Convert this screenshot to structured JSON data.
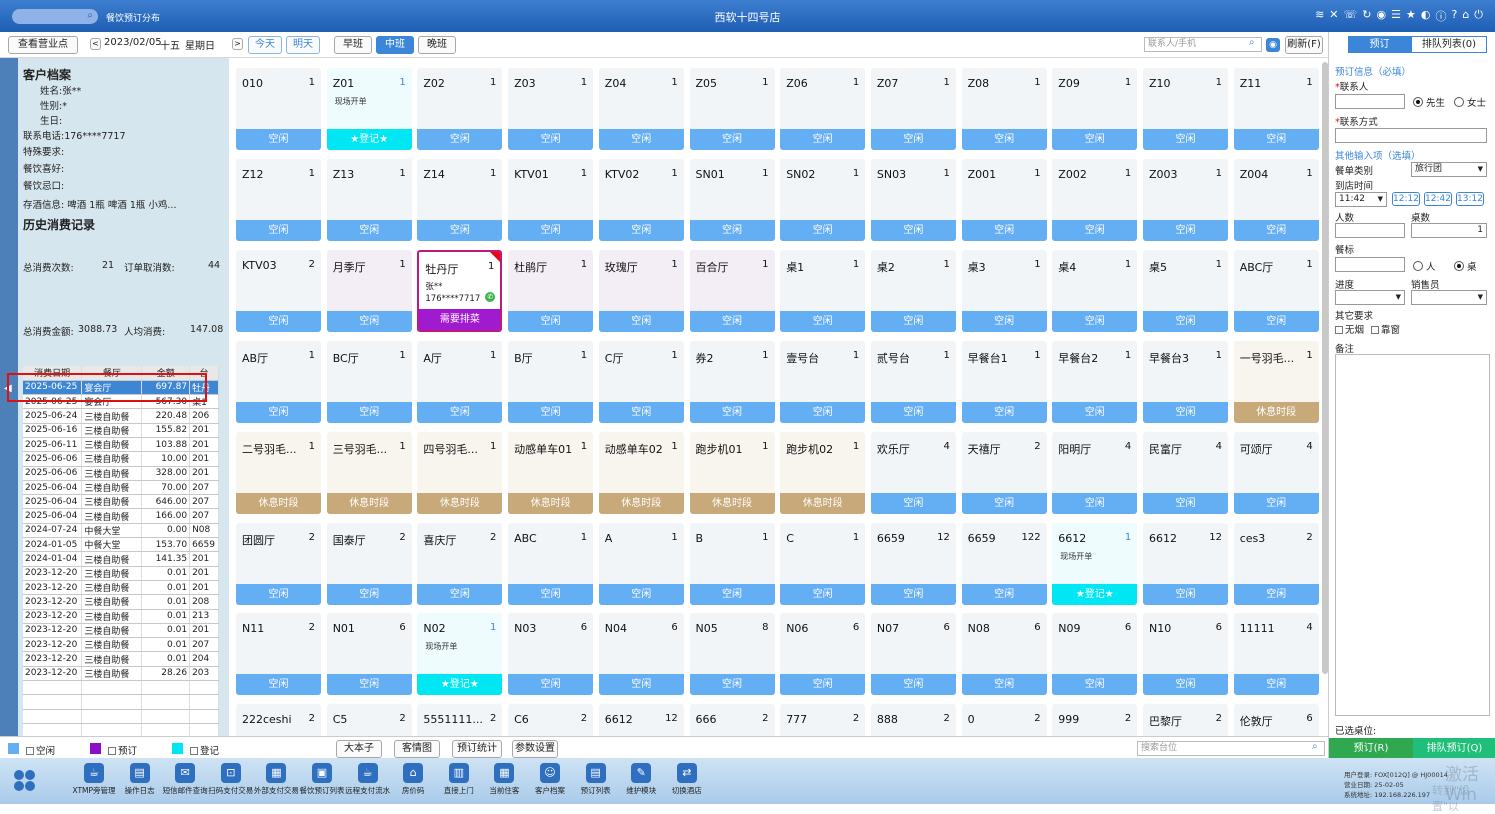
{
  "topbar": {
    "subtitle": "餐饮预订分布",
    "title": "西软十四号店",
    "icons": [
      "wifi-icon",
      "tools-icon",
      "phone-icon",
      "refresh-icon",
      "palette-icon",
      "menu-icon",
      "star-icon",
      "contrast-icon",
      "info-icon",
      "help-icon",
      "home-icon",
      "power-icon"
    ]
  },
  "toolbar": {
    "view_btn": "查看营业点",
    "prev": "<",
    "date": "2023/02/05",
    "lunar": "十五",
    "weekday": "星期日",
    "next": ">",
    "today": "今天",
    "tomorrow": "明天",
    "shifts": [
      "早班",
      "中班",
      "晚班"
    ],
    "contact_placeholder": "联系人/手机",
    "refresh": "刷新(F)"
  },
  "customer": {
    "title": "客户档案",
    "name_label": "姓名:",
    "name": "张**",
    "gender_label": "性别:",
    "gender": "*",
    "birthday_label": "生日:",
    "phone_label": "联系电话:",
    "phone": "176****7717",
    "special_label": "特殊要求:",
    "pref_label": "餐饮喜好:",
    "taboo_label": "餐饮忌口:",
    "wine_label": "存酒信息:",
    "wine": "啤酒 1瓶  啤酒 1瓶  小鸡..."
  },
  "history": {
    "title": "历史消费记录",
    "count_label": "总消费次数:",
    "count": "21",
    "cancel_label": "订单取消数:",
    "cancel": "44",
    "amount_label": "总消费金额:",
    "amount": "3088.73",
    "avg_label": "人均消费:",
    "avg": "147.08",
    "headers": [
      "消费日期",
      "餐厅",
      "金额",
      "台"
    ],
    "rows": [
      [
        "2025-06-25",
        "宴会厅",
        "697.87",
        "牡丹"
      ],
      [
        "2025-06-25",
        "宴会厅",
        "567.30",
        "桌1"
      ],
      [
        "2025-06-24",
        "三楼自助餐",
        "220.48",
        "206"
      ],
      [
        "2025-06-16",
        "三楼自助餐",
        "155.82",
        "201"
      ],
      [
        "2025-06-11",
        "三楼自助餐",
        "103.88",
        "201"
      ],
      [
        "2025-06-06",
        "三楼自助餐",
        "10.00",
        "201"
      ],
      [
        "2025-06-06",
        "三楼自助餐",
        "328.00",
        "201"
      ],
      [
        "2025-06-04",
        "三楼自助餐",
        "70.00",
        "207"
      ],
      [
        "2025-06-04",
        "三楼自助餐",
        "646.00",
        "207"
      ],
      [
        "2025-06-04",
        "三楼自助餐",
        "166.00",
        "207"
      ],
      [
        "2024-07-24",
        "中餐大堂",
        "0.00",
        "N08"
      ],
      [
        "2024-01-05",
        "中餐大堂",
        "153.70",
        "6659"
      ],
      [
        "2024-01-04",
        "三楼自助餐",
        "141.35",
        "201"
      ],
      [
        "2023-12-20",
        "三楼自助餐",
        "0.01",
        "201"
      ],
      [
        "2023-12-20",
        "三楼自助餐",
        "0.01",
        "201"
      ],
      [
        "2023-12-20",
        "三楼自助餐",
        "0.01",
        "208"
      ],
      [
        "2023-12-20",
        "三楼自助餐",
        "0.01",
        "213"
      ],
      [
        "2023-12-20",
        "三楼自助餐",
        "0.01",
        "201"
      ],
      [
        "2023-12-20",
        "三楼自助餐",
        "0.01",
        "207"
      ],
      [
        "2023-12-20",
        "三楼自助餐",
        "0.01",
        "204"
      ],
      [
        "2023-12-20",
        "三楼自助餐",
        "28.26",
        "203"
      ]
    ]
  },
  "tables": [
    [
      {
        "name": "010",
        "cap": "1",
        "status": "空闲"
      },
      {
        "name": "Z01",
        "cap": "1",
        "status": "★登记★",
        "note": "现场开单",
        "type": "cyan"
      },
      {
        "name": "Z02",
        "cap": "1",
        "status": "空闲"
      },
      {
        "name": "Z03",
        "cap": "1",
        "status": "空闲"
      },
      {
        "name": "Z04",
        "cap": "1",
        "status": "空闲"
      },
      {
        "name": "Z05",
        "cap": "1",
        "status": "空闲"
      },
      {
        "name": "Z06",
        "cap": "1",
        "status": "空闲"
      },
      {
        "name": "Z07",
        "cap": "1",
        "status": "空闲"
      },
      {
        "name": "Z08",
        "cap": "1",
        "status": "空闲"
      },
      {
        "name": "Z09",
        "cap": "1",
        "status": "空闲"
      },
      {
        "name": "Z10",
        "cap": "1",
        "status": "空闲"
      },
      {
        "name": "Z11",
        "cap": "1",
        "status": "空闲"
      }
    ],
    [
      {
        "name": "Z12",
        "cap": "1",
        "status": "空闲"
      },
      {
        "name": "Z13",
        "cap": "1",
        "status": "空闲"
      },
      {
        "name": "Z14",
        "cap": "1",
        "status": "空闲"
      },
      {
        "name": "KTV01",
        "cap": "1",
        "status": "空闲"
      },
      {
        "name": "KTV02",
        "cap": "1",
        "status": "空闲"
      },
      {
        "name": "SN01",
        "cap": "1",
        "status": "空闲"
      },
      {
        "name": "SN02",
        "cap": "1",
        "status": "空闲"
      },
      {
        "name": "SN03",
        "cap": "1",
        "status": "空闲"
      },
      {
        "name": "Z001",
        "cap": "1",
        "status": "空闲"
      },
      {
        "name": "Z002",
        "cap": "1",
        "status": "空闲"
      },
      {
        "name": "Z003",
        "cap": "1",
        "status": "空闲"
      },
      {
        "name": "Z004",
        "cap": "1",
        "status": "空闲"
      }
    ],
    [
      {
        "name": "KTV03",
        "cap": "2",
        "status": "空闲"
      },
      {
        "name": "月季厅",
        "cap": "1",
        "status": "空闲",
        "type": "pink"
      },
      {
        "name": "牡丹厅",
        "cap": "1",
        "status": "需要排菜",
        "type": "booked",
        "guest": "张**",
        "phone": "176****7717"
      },
      {
        "name": "杜鹃厅",
        "cap": "1",
        "status": "空闲",
        "type": "pink"
      },
      {
        "name": "玫瑰厅",
        "cap": "1",
        "status": "空闲",
        "type": "pink"
      },
      {
        "name": "百合厅",
        "cap": "1",
        "status": "空闲",
        "type": "pink"
      },
      {
        "name": "桌1",
        "cap": "1",
        "status": "空闲"
      },
      {
        "name": "桌2",
        "cap": "1",
        "status": "空闲"
      },
      {
        "name": "桌3",
        "cap": "1",
        "status": "空闲"
      },
      {
        "name": "桌4",
        "cap": "1",
        "status": "空闲"
      },
      {
        "name": "桌5",
        "cap": "1",
        "status": "空闲"
      },
      {
        "name": "ABC厅",
        "cap": "1",
        "status": "空闲"
      }
    ],
    [
      {
        "name": "AB厅",
        "cap": "1",
        "status": "空闲"
      },
      {
        "name": "BC厅",
        "cap": "1",
        "status": "空闲"
      },
      {
        "name": "A厅",
        "cap": "1",
        "status": "空闲"
      },
      {
        "name": "B厅",
        "cap": "1",
        "status": "空闲"
      },
      {
        "name": "C厅",
        "cap": "1",
        "status": "空闲"
      },
      {
        "name": "券2",
        "cap": "1",
        "status": "空闲"
      },
      {
        "name": "壹号台",
        "cap": "1",
        "status": "空闲"
      },
      {
        "name": "贰号台",
        "cap": "1",
        "status": "空闲"
      },
      {
        "name": "早餐台1",
        "cap": "1",
        "status": "空闲"
      },
      {
        "name": "早餐台2",
        "cap": "1",
        "status": "空闲"
      },
      {
        "name": "早餐台3",
        "cap": "1",
        "status": "空闲"
      },
      {
        "name": "一号羽毛...",
        "cap": "1",
        "status": "休息时段",
        "type": "beige"
      }
    ],
    [
      {
        "name": "二号羽毛...",
        "cap": "1",
        "status": "休息时段",
        "type": "beige"
      },
      {
        "name": "三号羽毛...",
        "cap": "1",
        "status": "休息时段",
        "type": "beige"
      },
      {
        "name": "四号羽毛...",
        "cap": "1",
        "status": "休息时段",
        "type": "beige"
      },
      {
        "name": "动感单车01",
        "cap": "1",
        "status": "休息时段",
        "type": "beige"
      },
      {
        "name": "动感单车02",
        "cap": "1",
        "status": "休息时段",
        "type": "beige"
      },
      {
        "name": "跑步机01",
        "cap": "1",
        "status": "休息时段",
        "type": "beige"
      },
      {
        "name": "跑步机02",
        "cap": "1",
        "status": "休息时段",
        "type": "beige"
      },
      {
        "name": "欢乐厅",
        "cap": "4",
        "status": "空闲"
      },
      {
        "name": "天禧厅",
        "cap": "2",
        "status": "空闲"
      },
      {
        "name": "阳明厅",
        "cap": "4",
        "status": "空闲"
      },
      {
        "name": "民富厅",
        "cap": "4",
        "status": "空闲"
      },
      {
        "name": "可颂厅",
        "cap": "4",
        "status": "空闲"
      }
    ],
    [
      {
        "name": "团圆厅",
        "cap": "2",
        "status": "空闲"
      },
      {
        "name": "国泰厅",
        "cap": "2",
        "status": "空闲"
      },
      {
        "name": "喜庆厅",
        "cap": "2",
        "status": "空闲"
      },
      {
        "name": "ABC",
        "cap": "1",
        "status": "空闲"
      },
      {
        "name": "A",
        "cap": "1",
        "status": "空闲"
      },
      {
        "name": "B",
        "cap": "1",
        "status": "空闲"
      },
      {
        "name": "C",
        "cap": "1",
        "status": "空闲"
      },
      {
        "name": "6659",
        "cap": "12",
        "status": "空闲"
      },
      {
        "name": "6659",
        "cap": "122",
        "status": "空闲"
      },
      {
        "name": "6612",
        "cap": "1",
        "status": "★登记★",
        "note": "现场开单",
        "type": "cyan"
      },
      {
        "name": "6612",
        "cap": "12",
        "status": "空闲"
      },
      {
        "name": "ces3",
        "cap": "2",
        "status": "空闲"
      }
    ],
    [
      {
        "name": "N11",
        "cap": "2",
        "status": "空闲"
      },
      {
        "name": "N01",
        "cap": "6",
        "status": "空闲"
      },
      {
        "name": "N02",
        "cap": "1",
        "status": "★登记★",
        "note": "现场开单",
        "type": "cyan"
      },
      {
        "name": "N03",
        "cap": "6",
        "status": "空闲"
      },
      {
        "name": "N04",
        "cap": "6",
        "status": "空闲"
      },
      {
        "name": "N05",
        "cap": "8",
        "status": "空闲"
      },
      {
        "name": "N06",
        "cap": "6",
        "status": "空闲"
      },
      {
        "name": "N07",
        "cap": "6",
        "status": "空闲"
      },
      {
        "name": "N08",
        "cap": "6",
        "status": "空闲"
      },
      {
        "name": "N09",
        "cap": "6",
        "status": "空闲"
      },
      {
        "name": "N10",
        "cap": "6",
        "status": "空闲"
      },
      {
        "name": "11111",
        "cap": "4",
        "status": "空闲"
      }
    ],
    [
      {
        "name": "222ceshi",
        "cap": "2"
      },
      {
        "name": "C5",
        "cap": "2"
      },
      {
        "name": "5551111...",
        "cap": "2"
      },
      {
        "name": "C6",
        "cap": "2"
      },
      {
        "name": "6612",
        "cap": "12"
      },
      {
        "name": "666",
        "cap": "2"
      },
      {
        "name": "777",
        "cap": "2"
      },
      {
        "name": "888",
        "cap": "2"
      },
      {
        "name": "0",
        "cap": "2"
      },
      {
        "name": "999",
        "cap": "2"
      },
      {
        "name": "巴黎厅",
        "cap": "2"
      },
      {
        "name": "伦敦厅",
        "cap": "6"
      }
    ]
  ],
  "right": {
    "tab_book": "预订",
    "tab_queue": "排队列表(0)",
    "sec_required": "预订信息（必填）",
    "contact_label": "联系人",
    "mr": "先生",
    "ms": "女士",
    "contact_way_label": "联系方式",
    "sec_optional": "其他输入项（选填）",
    "meal_type_label": "餐单类别",
    "meal_type": "旅行团",
    "arrive_label": "到店时间",
    "arrive_time": "11:42",
    "quick_times": [
      "12:12",
      "12:42",
      "13:12"
    ],
    "people_label": "人数",
    "tables_label": "桌数",
    "tables_value": "1",
    "standard_label": "餐标",
    "per_person": "人",
    "per_table": "桌",
    "progress_label": "进度",
    "sales_label": "销售员",
    "other_label": "其它要求",
    "no_smoke": "无烟",
    "window": "靠窗",
    "remark_label": "备注",
    "selected_label": "已选桌位:",
    "book_btn": "预订(R)",
    "queue_btn": "排队预订(Q)"
  },
  "legend": {
    "free": "空闲",
    "booked": "预订",
    "registered": "登记",
    "colors": {
      "free": "#64aef3",
      "booked": "#8a0fc8",
      "registered": "#00e6f2"
    },
    "btns": [
      "大本子",
      "客情图",
      "预订统计",
      "参数设置"
    ],
    "search_placeholder": "搜索台位"
  },
  "bottom": {
    "items": [
      "XTMP旁管理",
      "操作日志",
      "短信邮件查询",
      "扫码支付交易",
      "外部支付交易",
      "餐饮预订列表",
      "远程支付流水",
      "房价码",
      "直接上门",
      "当前住客",
      "客户档案",
      "预订列表",
      "维护模块",
      "切换酒店"
    ],
    "sys_user": "用户登录: FOX[012Q] @ HJ00014",
    "sys_date": "营业日期: 25-02-05",
    "sys_ip": "系统地址: 192.168.226.197",
    "watermark1": "激活 Win",
    "watermark2": "转到\"设置\"以"
  }
}
